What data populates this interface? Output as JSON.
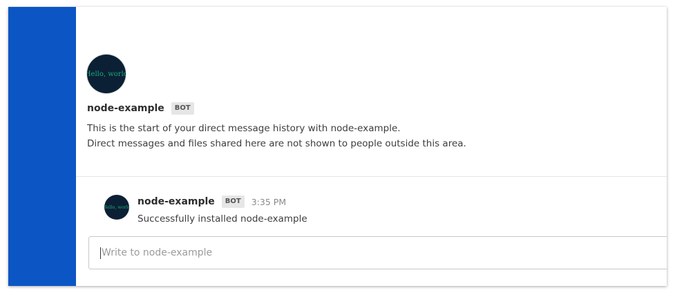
{
  "colors": {
    "sidebar": "#0b56c4",
    "avatar_bg": "#0b2034",
    "avatar_text": "#1aa87a"
  },
  "bot": {
    "name": "node-example",
    "badge": "BOT",
    "avatar_text": "Hello, world"
  },
  "intro": {
    "line1": "This is the start of your direct message history with node-example.",
    "line2": "Direct messages and files shared here are not shown to people outside this area."
  },
  "post": {
    "author": "node-example",
    "badge": "BOT",
    "time": "3:35 PM",
    "message": "Successfully installed node-example"
  },
  "composer": {
    "placeholder": "Write to node-example"
  }
}
